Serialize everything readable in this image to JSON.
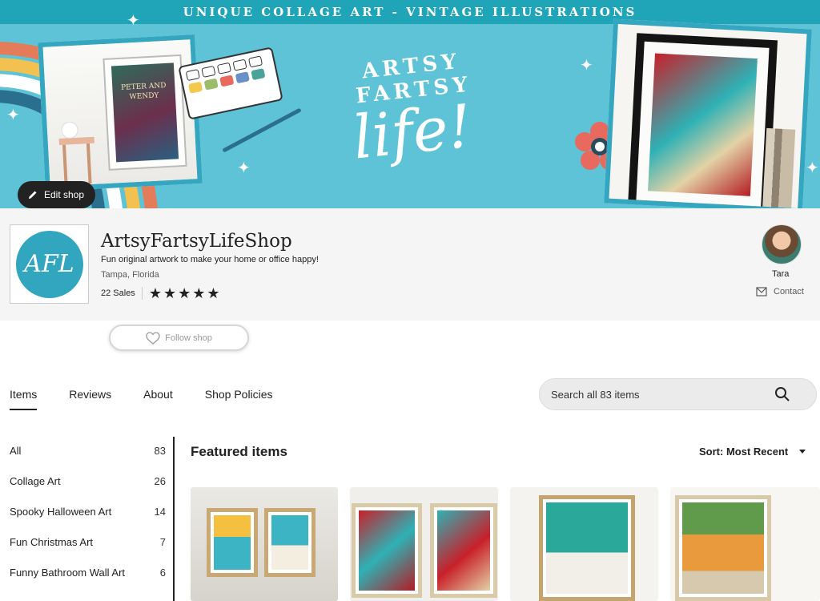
{
  "banner": {
    "strip_text": "UNIQUE COLLAGE ART - VINTAGE ILLUSTRATIONS",
    "title_line1": "ARTSY FARTSY",
    "title_line2": "life!",
    "book_title": "PETER AND WENDY",
    "edit_shop_label": "Edit shop"
  },
  "shop": {
    "logo_text": "AFL",
    "name": "ArtsyFartsyLifeShop",
    "tagline": "Fun original artwork to make your home or office happy!",
    "location": "Tampa, Florida",
    "sales": "22 Sales",
    "rating_stars": 5,
    "owner_name": "Tara",
    "contact_label": "Contact",
    "follow_label": "Follow shop"
  },
  "tabs": [
    "Items",
    "Reviews",
    "About",
    "Shop Policies"
  ],
  "search": {
    "placeholder": "Search all 83 items"
  },
  "sidebar": {
    "categories": [
      {
        "label": "All",
        "count": "83"
      },
      {
        "label": "Collage Art",
        "count": "26"
      },
      {
        "label": "Spooky Halloween Art",
        "count": "14"
      },
      {
        "label": "Fun Christmas Art",
        "count": "7"
      },
      {
        "label": "Funny Bathroom Wall Art",
        "count": "6"
      }
    ]
  },
  "main": {
    "featured_title": "Featured items",
    "sort_label": "Sort: Most Recent"
  },
  "colors": {
    "banner_bg": "#5ec3d6",
    "banner_strip": "#1fa4b8",
    "accent_teal": "#32a5bf",
    "text": "#222222"
  }
}
